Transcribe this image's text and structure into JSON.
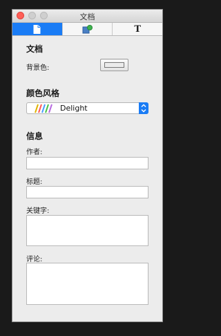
{
  "window": {
    "title": "文档"
  },
  "tabs": [
    {
      "icon": "document-icon",
      "active": true
    },
    {
      "icon": "shapes-icon",
      "active": false
    },
    {
      "icon": "text-icon",
      "label": "T",
      "active": false
    }
  ],
  "document": {
    "heading": "文档",
    "background_label": "背景色:",
    "background_color": "#ececec"
  },
  "color_style": {
    "heading": "颜色风格",
    "selected": "Delight",
    "swatch_colors": [
      "#e0b400",
      "#ff5a5a",
      "#4a9bff",
      "#47c247",
      "#b86be0"
    ]
  },
  "info": {
    "heading": "信息",
    "author_label": "作者:",
    "author_value": "",
    "title_label": "标题:",
    "title_value": "",
    "keywords_label": "关键字:",
    "keywords_value": "",
    "comments_label": "评论:",
    "comments_value": ""
  },
  "colors": {
    "accent": "#1a7cf5",
    "panel": "#ececec",
    "close": "#ff5f57"
  }
}
